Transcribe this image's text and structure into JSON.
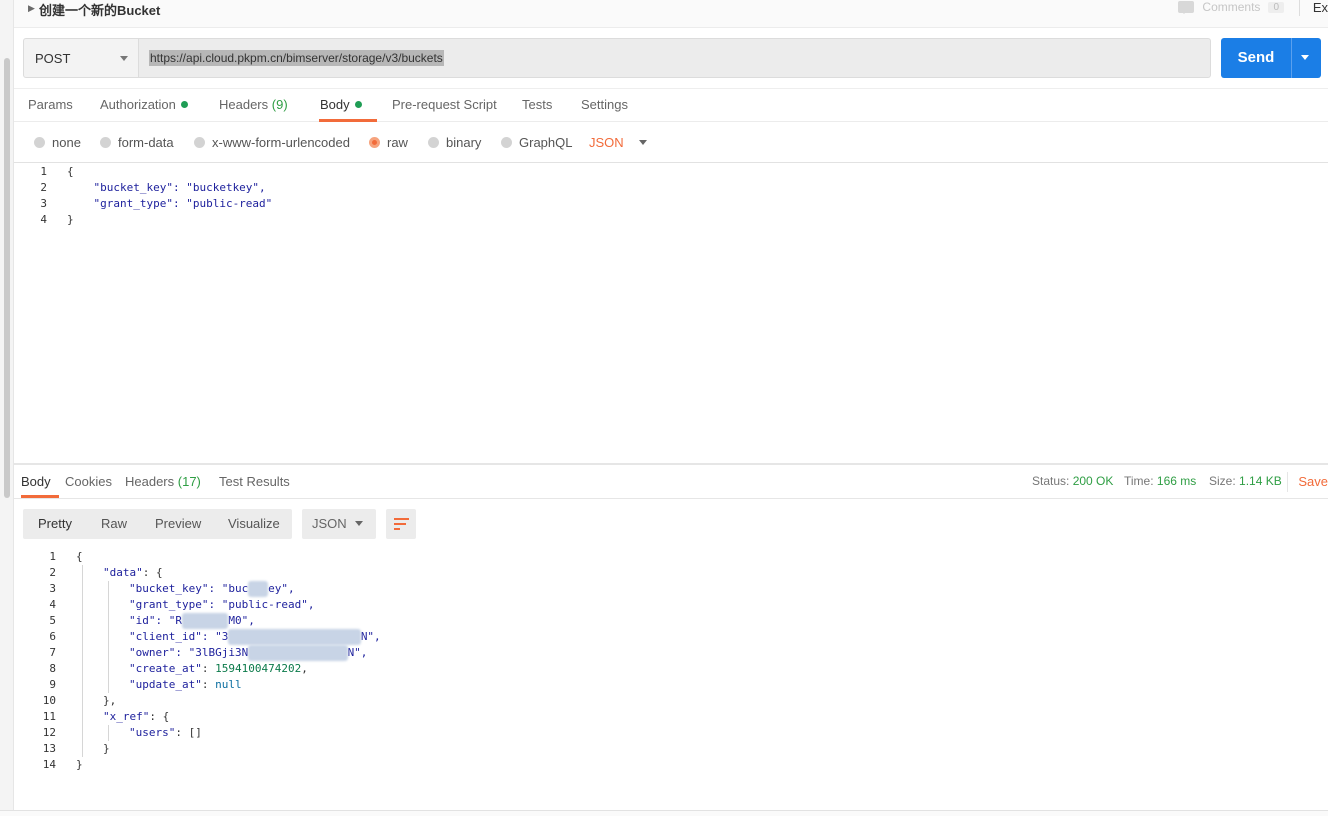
{
  "header": {
    "request_name": "创建一个新的Bucket",
    "comments_label": "Comments",
    "comments_count": "0",
    "right_cut_text": "Ex"
  },
  "request": {
    "method": "POST",
    "url": "https://api.cloud.pkpm.cn/bimserver/storage/v3/buckets",
    "send_label": "Send"
  },
  "request_tabs": [
    {
      "label": "Params"
    },
    {
      "label": "Authorization"
    },
    {
      "label": "Headers",
      "count": "(9)"
    },
    {
      "label": "Body"
    },
    {
      "label": "Pre-request Script"
    },
    {
      "label": "Tests"
    },
    {
      "label": "Settings"
    }
  ],
  "body_types": [
    "none",
    "form-data",
    "x-www-form-urlencoded",
    "raw",
    "binary",
    "GraphQL"
  ],
  "body_format": "JSON",
  "request_body": {
    "line_numbers": [
      "1",
      "2",
      "3",
      "4"
    ],
    "lines": [
      "{",
      "    \"bucket_key\": \"bucketkey\",",
      "    \"grant_type\": \"public-read\"",
      "}"
    ]
  },
  "response_tabs": [
    {
      "label": "Body"
    },
    {
      "label": "Cookies"
    },
    {
      "label": "Headers",
      "count": "(17)"
    },
    {
      "label": "Test Results"
    }
  ],
  "response_meta": {
    "status_label": "Status:",
    "status_value": "200 OK",
    "time_label": "Time:",
    "time_value": "166 ms",
    "size_label": "Size:",
    "size_value": "1.14 KB",
    "save_label": "Save"
  },
  "view_modes": [
    "Pretty",
    "Raw",
    "Preview",
    "Visualize"
  ],
  "response_format": "JSON",
  "response_body": {
    "line_numbers": [
      "1",
      "2",
      "3",
      "4",
      "5",
      "6",
      "7",
      "8",
      "9",
      "10",
      "11",
      "12",
      "13",
      "14"
    ],
    "lines": {
      "l1": "{",
      "l2_key": "\"data\"",
      "l2_rest": ": {",
      "l3_key": "\"bucket_key\"",
      "l3_pre": ": \"buc",
      "l3_post": "ey\",",
      "l4_key": "\"grant_type\"",
      "l4_rest": ": \"public-read\",",
      "l5_key": "\"id\"",
      "l5_pre": ": \"R",
      "l5_post": "M0\",",
      "l6_key": "\"client_id\"",
      "l6_pre": ": \"3",
      "l6_post": "N\",",
      "l7_key": "\"owner\"",
      "l7_pre": ": \"3lBGji3N",
      "l7_post": "N\",",
      "l8_key": "\"create_at\"",
      "l8_sep": ": ",
      "l8_val": "1594100474202",
      "l8_end": ",",
      "l9_key": "\"update_at\"",
      "l9_sep": ": ",
      "l9_val": "null",
      "l10": "},",
      "l11_key": "\"x_ref\"",
      "l11_rest": ": {",
      "l12_key": "\"users\"",
      "l12_rest": ": []",
      "l13": "}",
      "l14": "}"
    }
  }
}
